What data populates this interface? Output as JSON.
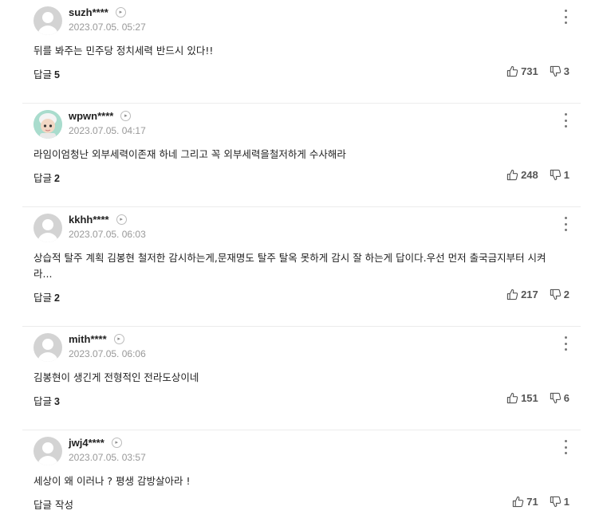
{
  "comments": [
    {
      "nick": "suzh****",
      "date": "2023.07.05. 05:27",
      "text": "뒤를 봐주는 민주당 정치세력 반드시 있다!!",
      "reply_label": "답글",
      "reply_count": "5",
      "likes": "731",
      "dislikes": "3",
      "avatar": "default"
    },
    {
      "nick": "wpwn****",
      "date": "2023.07.05. 04:17",
      "text": "라임이엄청난 외부세력이존재 하네 그리고 꼭 외부세력을철저하게 수사해라",
      "reply_label": "답글",
      "reply_count": "2",
      "likes": "248",
      "dislikes": "1",
      "avatar": "custom"
    },
    {
      "nick": "kkhh****",
      "date": "2023.07.05. 06:03",
      "text": "상습적 탈주 계획 김봉현 철저한 감시하는게,문재명도 탈주 탈옥 못하게 감시 잘 하는게 답이다.우선 먼저 출국금지부터 시켜라...",
      "reply_label": "답글",
      "reply_count": "2",
      "likes": "217",
      "dislikes": "2",
      "avatar": "default"
    },
    {
      "nick": "mith****",
      "date": "2023.07.05. 06:06",
      "text": "김봉현이 생긴게 전형적인 전라도상이네",
      "reply_label": "답글",
      "reply_count": "3",
      "likes": "151",
      "dislikes": "6",
      "avatar": "default"
    },
    {
      "nick": "jwj4****",
      "date": "2023.07.05. 03:57",
      "text": "세상이 왜 이러나 ? 평생 감방살아라 !",
      "reply_label": "답글 작성",
      "reply_count": "",
      "likes": "71",
      "dislikes": "1",
      "avatar": "default"
    }
  ],
  "icons": {
    "profile": "chevron-right-icon",
    "more": "more-vertical-icon",
    "like": "thumb-up-icon",
    "dislike": "thumb-down-icon",
    "avatar_default": "default-avatar-icon"
  }
}
